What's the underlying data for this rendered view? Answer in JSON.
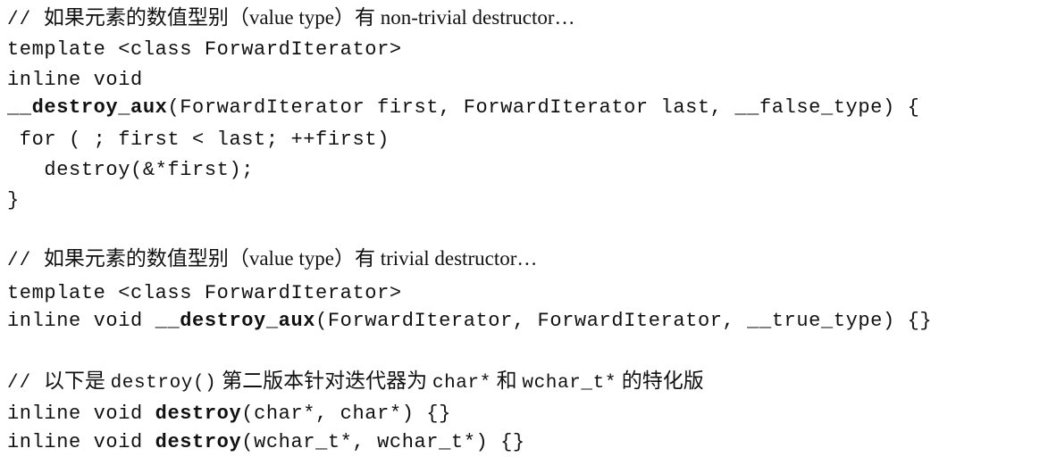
{
  "code": {
    "comment_nontrivial": {
      "slashes": "// ",
      "text": "如果元素的数值型别（value type）有 non-trivial destructor…"
    },
    "template_line_1": "template <class ForwardIterator>",
    "inline_void": "inline void",
    "aux_nontrivial": {
      "name": "__destroy_aux",
      "params": "(ForwardIterator first, ForwardIterator last, __false_type) {"
    },
    "for_line": " for ( ; first < last; ++first)",
    "destroy_call": "   destroy(&*first);",
    "close_brace": "}",
    "comment_trivial": {
      "slashes": "// ",
      "text": "如果元素的数值型别（value type）有 trivial destructor…"
    },
    "template_line_2": "template <class ForwardIterator>",
    "aux_trivial": {
      "prefix": "inline void ",
      "name": "__destroy_aux",
      "params": "(ForwardIterator, ForwardIterator, __true_type) {}"
    },
    "comment_special": {
      "slashes": "// ",
      "text_a": "以下是 ",
      "code_a": "destroy()",
      "text_b": " 第二版本针对迭代器为 ",
      "code_b": "char*",
      "text_c": " 和 ",
      "code_c": "wchar_t*",
      "text_d": " 的特化版"
    },
    "destroy_char": {
      "prefix": "inline void ",
      "name": "destroy",
      "params": "(char*, char*) {}"
    },
    "destroy_wchar": {
      "prefix": "inline void ",
      "name": "destroy",
      "params": "(wchar_t*, wchar_t*) {}"
    }
  }
}
